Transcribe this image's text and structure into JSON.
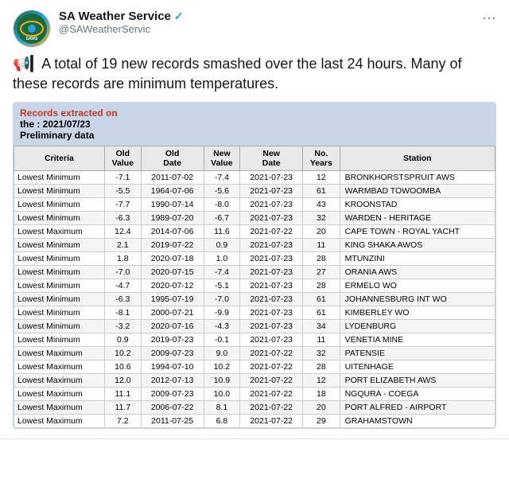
{
  "header": {
    "account_name": "SA Weather Service",
    "account_handle": "@SAWeatherServic",
    "verified": true,
    "more_options_label": "···"
  },
  "tweet": {
    "text": "A total of 19 new records smashed over the last 24 hours. Many of these records are minimum temperatures.",
    "megaphone_emoji": "📢",
    "bar_emoji": "▎"
  },
  "card": {
    "header_line1": "Records extracted on",
    "header_line2": "the : 2021/07/23",
    "header_line3": "Preliminary data"
  },
  "table": {
    "columns": [
      "Criteria",
      "Old Value",
      "Old Date",
      "New Value",
      "New Date",
      "No. Years",
      "Station"
    ],
    "rows": [
      [
        "Lowest Minimum",
        "-7.1",
        "2011-07-02",
        "-7.4",
        "2021-07-23",
        "12",
        "BRONKHORSTSPRUIT AWS"
      ],
      [
        "Lowest Minimum",
        "-5.5",
        "1964-07-06",
        "-5.6",
        "2021-07-23",
        "61",
        "WARMBAD TOWOOMBA"
      ],
      [
        "Lowest Minimum",
        "-7.7",
        "1990-07-14",
        "-8.0",
        "2021-07-23",
        "43",
        "KROONSTAD"
      ],
      [
        "Lowest Minimum",
        "-6.3",
        "1989-07-20",
        "-6.7",
        "2021-07-23",
        "32",
        "WARDEN - HERITAGE"
      ],
      [
        "Lowest Maximum",
        "12.4",
        "2014-07-06",
        "11.6",
        "2021-07-22",
        "20",
        "CAPE TOWN - ROYAL YACHT"
      ],
      [
        "Lowest Minimum",
        "2.1",
        "2019-07-22",
        "0.9",
        "2021-07-23",
        "11",
        "KING SHAKA AWOS"
      ],
      [
        "Lowest Minimum",
        "1.8",
        "2020-07-18",
        "1.0",
        "2021-07-23",
        "28",
        "MTUNZINI"
      ],
      [
        "Lowest Minimum",
        "-7.0",
        "2020-07-15",
        "-7.4",
        "2021-07-23",
        "27",
        "ORANIA AWS"
      ],
      [
        "Lowest Minimum",
        "-4.7",
        "2020-07-12",
        "-5.1",
        "2021-07-23",
        "28",
        "ERMELO WO"
      ],
      [
        "Lowest Minimum",
        "-6.3",
        "1995-07-19",
        "-7.0",
        "2021-07-23",
        "61",
        "JOHANNESBURG INT WO"
      ],
      [
        "Lowest Minimum",
        "-8.1",
        "2000-07-21",
        "-9.9",
        "2021-07-23",
        "61",
        "KIMBERLEY WO"
      ],
      [
        "Lowest Minimum",
        "-3.2",
        "2020-07-16",
        "-4.3",
        "2021-07-23",
        "34",
        "LYDENBURG"
      ],
      [
        "Lowest Minimum",
        "0.9",
        "2019-07-23",
        "-0.1",
        "2021-07-23",
        "11",
        "VENETIA MINE"
      ],
      [
        "Lowest Maximum",
        "10.2",
        "2009-07-23",
        "9.0",
        "2021-07-22",
        "32",
        "PATENSIE"
      ],
      [
        "Lowest Maximum",
        "10.6",
        "1994-07-10",
        "10.2",
        "2021-07-22",
        "28",
        "UITENHAGE"
      ],
      [
        "Lowest Maximum",
        "12.0",
        "2012-07-13",
        "10.9",
        "2021-07-22",
        "12",
        "PORT ELIZABETH AWS"
      ],
      [
        "Lowest Maximum",
        "11.1",
        "2009-07-23",
        "10.0",
        "2021-07-22",
        "18",
        "NGQURA - COEGA"
      ],
      [
        "Lowest Maximum",
        "11.7",
        "2006-07-22",
        "8.1",
        "2021-07-22",
        "20",
        "PORT ALFRED - AIRPORT"
      ],
      [
        "Lowest Maximum",
        "7.2",
        "2011-07-25",
        "6.8",
        "2021-07-22",
        "29",
        "GRAHAMSTOWN"
      ]
    ]
  }
}
